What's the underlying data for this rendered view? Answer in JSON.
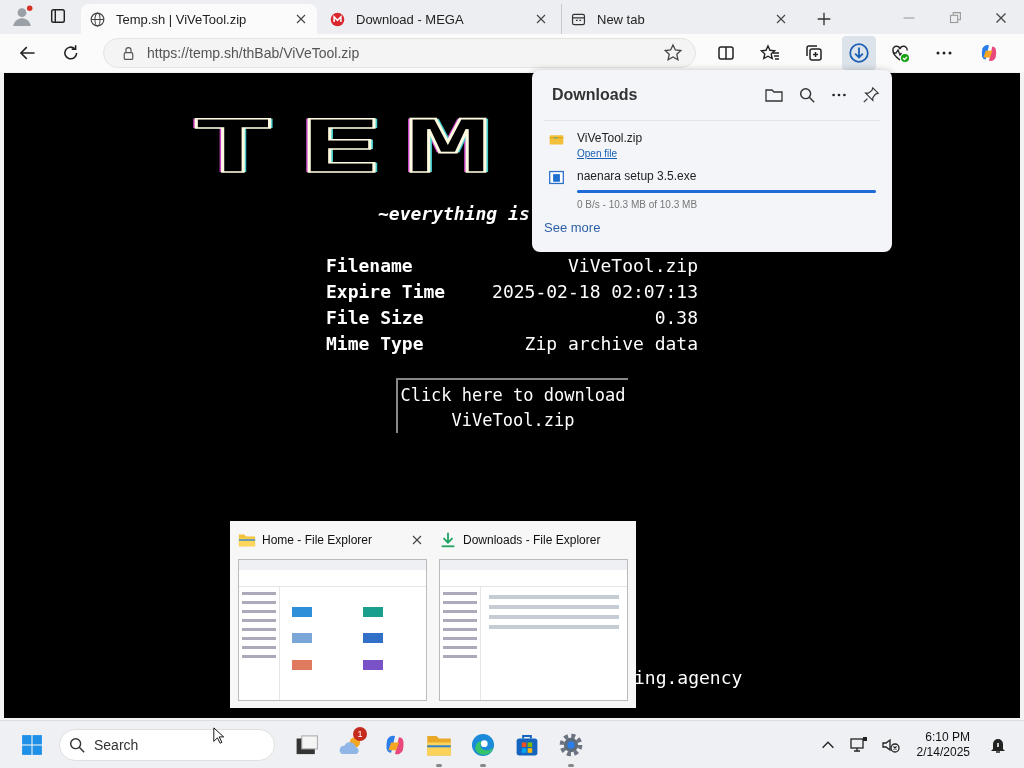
{
  "browser": {
    "tabs": [
      {
        "title": "Temp.sh | ViVeTool.zip",
        "selected": true
      },
      {
        "title": "Download - MEGA",
        "selected": false
      },
      {
        "title": "New tab",
        "selected": false
      }
    ],
    "address": "https://temp.sh/thBab/ViVeTool.zip",
    "downloads_open": true
  },
  "page": {
    "logo": "TEM",
    "tagline": "~everything is",
    "info": [
      {
        "label": "Filename",
        "value": "ViVeTool.zip"
      },
      {
        "label": "Expire Time",
        "value": "2025-02-18 02:07:13"
      },
      {
        "label": "File Size",
        "value": "0.38"
      },
      {
        "label": "Mime Type",
        "value": "Zip archive data"
      }
    ],
    "download_button": [
      "Click here to download",
      "ViVeTool.zip"
    ],
    "footer": "ing.agency"
  },
  "downloads_panel": {
    "title": "Downloads",
    "items": [
      {
        "kind": "done",
        "name": "ViVeTool.zip",
        "action": "Open file"
      },
      {
        "kind": "progress",
        "name": "naenara setup 3.5.exe",
        "level": 1,
        "status": "0 B/s - 10.3 MB of 10.3 MB"
      }
    ],
    "see_more": "See more"
  },
  "thumbnails": [
    {
      "title": "Home - File Explorer",
      "hovered": true
    },
    {
      "title": "Downloads - File Explorer",
      "hovered": false
    }
  ],
  "taskbar": {
    "search_placeholder": "Search",
    "apps": [
      {
        "kind": "taskview",
        "running": false
      },
      {
        "kind": "weather",
        "running": false,
        "badge": "1"
      },
      {
        "kind": "copilot",
        "running": false
      },
      {
        "kind": "explorer",
        "running": true
      },
      {
        "kind": "edge",
        "running": true
      },
      {
        "kind": "store",
        "running": false
      },
      {
        "kind": "settings",
        "running": true
      }
    ],
    "time": "6:10 PM",
    "date": "2/14/2025"
  }
}
